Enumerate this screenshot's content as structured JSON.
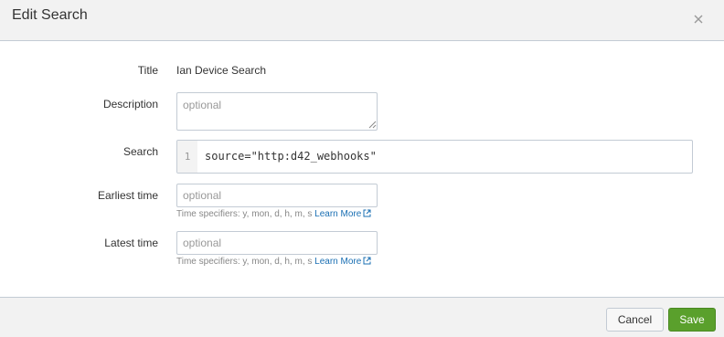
{
  "dialog": {
    "title": "Edit Search",
    "close_icon": "close-icon"
  },
  "form": {
    "title_label": "Title",
    "title_value": "Ian Device Search",
    "description_label": "Description",
    "description_placeholder": "optional",
    "search_label": "Search",
    "search_line_number": "1",
    "search_query": "source=\"http:d42_webhooks\"",
    "earliest_label": "Earliest time",
    "earliest_placeholder": "optional",
    "earliest_help": "Time specifiers: y, mon, d, h, m, s",
    "earliest_link": "Learn More",
    "latest_label": "Latest time",
    "latest_placeholder": "optional",
    "latest_help": "Time specifiers: y, mon, d, h, m, s",
    "latest_link": "Learn More",
    "link_icon": "external-link-icon"
  },
  "footer": {
    "cancel_label": "Cancel",
    "save_label": "Save"
  },
  "colors": {
    "accent_save": "#5aa02c",
    "link": "#1a6fb3"
  }
}
